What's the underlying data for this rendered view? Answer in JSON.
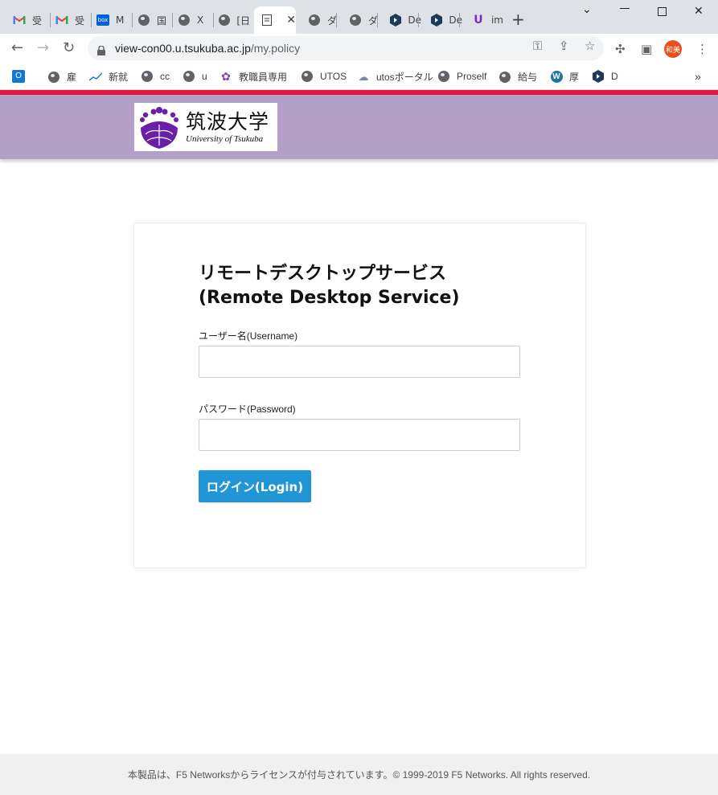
{
  "browser": {
    "tabs": [
      {
        "label": "受",
        "icon": "gmail-icon"
      },
      {
        "label": "受",
        "icon": "gmail-icon"
      },
      {
        "label": "M",
        "icon": "box-icon"
      },
      {
        "label": "国",
        "icon": "globe-icon"
      },
      {
        "label": "X",
        "icon": "globe-icon"
      },
      {
        "label": "[日",
        "icon": "globe-icon"
      },
      {
        "label": "",
        "icon": "page-icon",
        "active": true
      },
      {
        "label": "ダ",
        "icon": "globe-icon"
      },
      {
        "label": "ダ",
        "icon": "globe-icon"
      },
      {
        "label": "De",
        "icon": "hexagon-icon"
      },
      {
        "label": "De",
        "icon": "hexagon-icon"
      },
      {
        "label": "im",
        "icon": "u-icon"
      }
    ],
    "new_tab_symbol": "+",
    "url_host": "view-con00.u.tsukuba.ac.jp",
    "url_path": "/my.policy",
    "profile_label": "和美",
    "bookmarks": [
      {
        "label": "",
        "icon": "outlook-icon"
      },
      {
        "label": "雇",
        "icon": "globe-icon"
      },
      {
        "label": "新就",
        "icon": "chart-icon"
      },
      {
        "label": "cc",
        "icon": "globe-icon"
      },
      {
        "label": "u",
        "icon": "globe-icon"
      },
      {
        "label": "教職員専用",
        "icon": "grape-icon"
      },
      {
        "label": "UTOS",
        "icon": "globe-icon"
      },
      {
        "label": "utosポータル",
        "icon": "cloud-icon"
      },
      {
        "label": "Proself",
        "icon": "globe-icon"
      },
      {
        "label": "給与",
        "icon": "globe-icon"
      },
      {
        "label": "厚",
        "icon": "wordpress-icon"
      },
      {
        "label": "D",
        "icon": "hexagon-icon"
      }
    ],
    "bookmarks_overflow": "»"
  },
  "page": {
    "logo_jp": "筑波大学",
    "logo_en": "University of Tsukuba",
    "title_line1": "リモートデスクトップサービス",
    "title_line2": "(Remote Desktop Service)",
    "username_label": "ユーザー名(Username)",
    "username_value": "",
    "password_label": "パスワード(Password)",
    "password_value": "",
    "login_button": "ログイン(Login)",
    "footer": "本製品は、F5 Networksからライセンスが付与されています。© 1999-2019 F5 Networks. All rights reserved."
  },
  "colors": {
    "accent_red": "#e3173b",
    "header_purple": "#b3a0c8",
    "button_blue": "#2196d6"
  }
}
